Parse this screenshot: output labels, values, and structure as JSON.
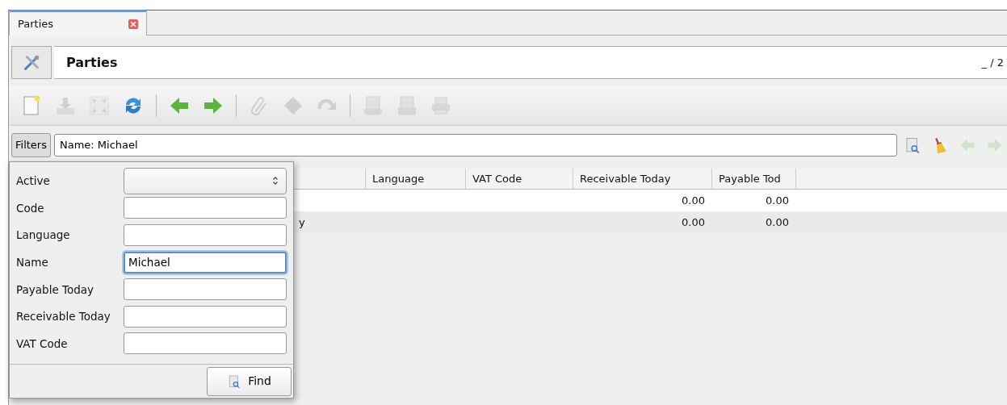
{
  "tab": {
    "label": "Parties",
    "selected": true
  },
  "header": {
    "title": "Parties",
    "record_count": "_ / 2"
  },
  "toolbar": [
    {
      "kind": "new",
      "disabled": false
    },
    {
      "kind": "save",
      "disabled": true
    },
    {
      "kind": "switch",
      "disabled": true
    },
    {
      "kind": "reload",
      "disabled": false
    },
    {
      "kind": "separator"
    },
    {
      "kind": "previous",
      "disabled": false
    },
    {
      "kind": "next",
      "disabled": false
    },
    {
      "kind": "separator"
    },
    {
      "kind": "attach",
      "disabled": true
    },
    {
      "kind": "action",
      "disabled": true
    },
    {
      "kind": "relate",
      "disabled": true
    },
    {
      "kind": "separator"
    },
    {
      "kind": "report",
      "disabled": true
    },
    {
      "kind": "email",
      "disabled": true
    },
    {
      "kind": "print",
      "disabled": true
    }
  ],
  "filter": {
    "button": "Filters",
    "value": "Name: Michael",
    "nav": [
      {
        "kind": "search",
        "disabled": false
      },
      {
        "kind": "clear",
        "disabled": false
      },
      {
        "kind": "previous",
        "disabled": true
      },
      {
        "kind": "next",
        "disabled": true
      }
    ]
  },
  "filter_popup": {
    "fields": [
      {
        "label": "Active",
        "kind": "select",
        "focused": false
      },
      {
        "label": "Code",
        "kind": "text",
        "focused": false
      },
      {
        "label": "Language",
        "kind": "text",
        "focused": false
      },
      {
        "label": "Name",
        "kind": "text",
        "value": "Michael",
        "focused": true
      },
      {
        "label": "Payable Today",
        "kind": "text",
        "focused": false
      },
      {
        "label": "Receivable Today",
        "kind": "text",
        "focused": false
      },
      {
        "label": "VAT Code",
        "kind": "text",
        "focused": false
      }
    ],
    "find_button": "Find"
  },
  "table": {
    "columns": [
      {
        "kind": "text"
      },
      {
        "kind": "text",
        "label": "Language"
      },
      {
        "kind": "text",
        "label": "VAT Code"
      },
      {
        "kind": "number",
        "label": "Receivable Today"
      },
      {
        "kind": "number",
        "label": "Payable Tod"
      }
    ],
    "rows": [
      {
        "cells": [
          null,
          null,
          null,
          "0.00",
          "0.00"
        ]
      },
      {
        "cells": [
          "y",
          null,
          null,
          "0.00",
          "0.00"
        ]
      }
    ]
  }
}
